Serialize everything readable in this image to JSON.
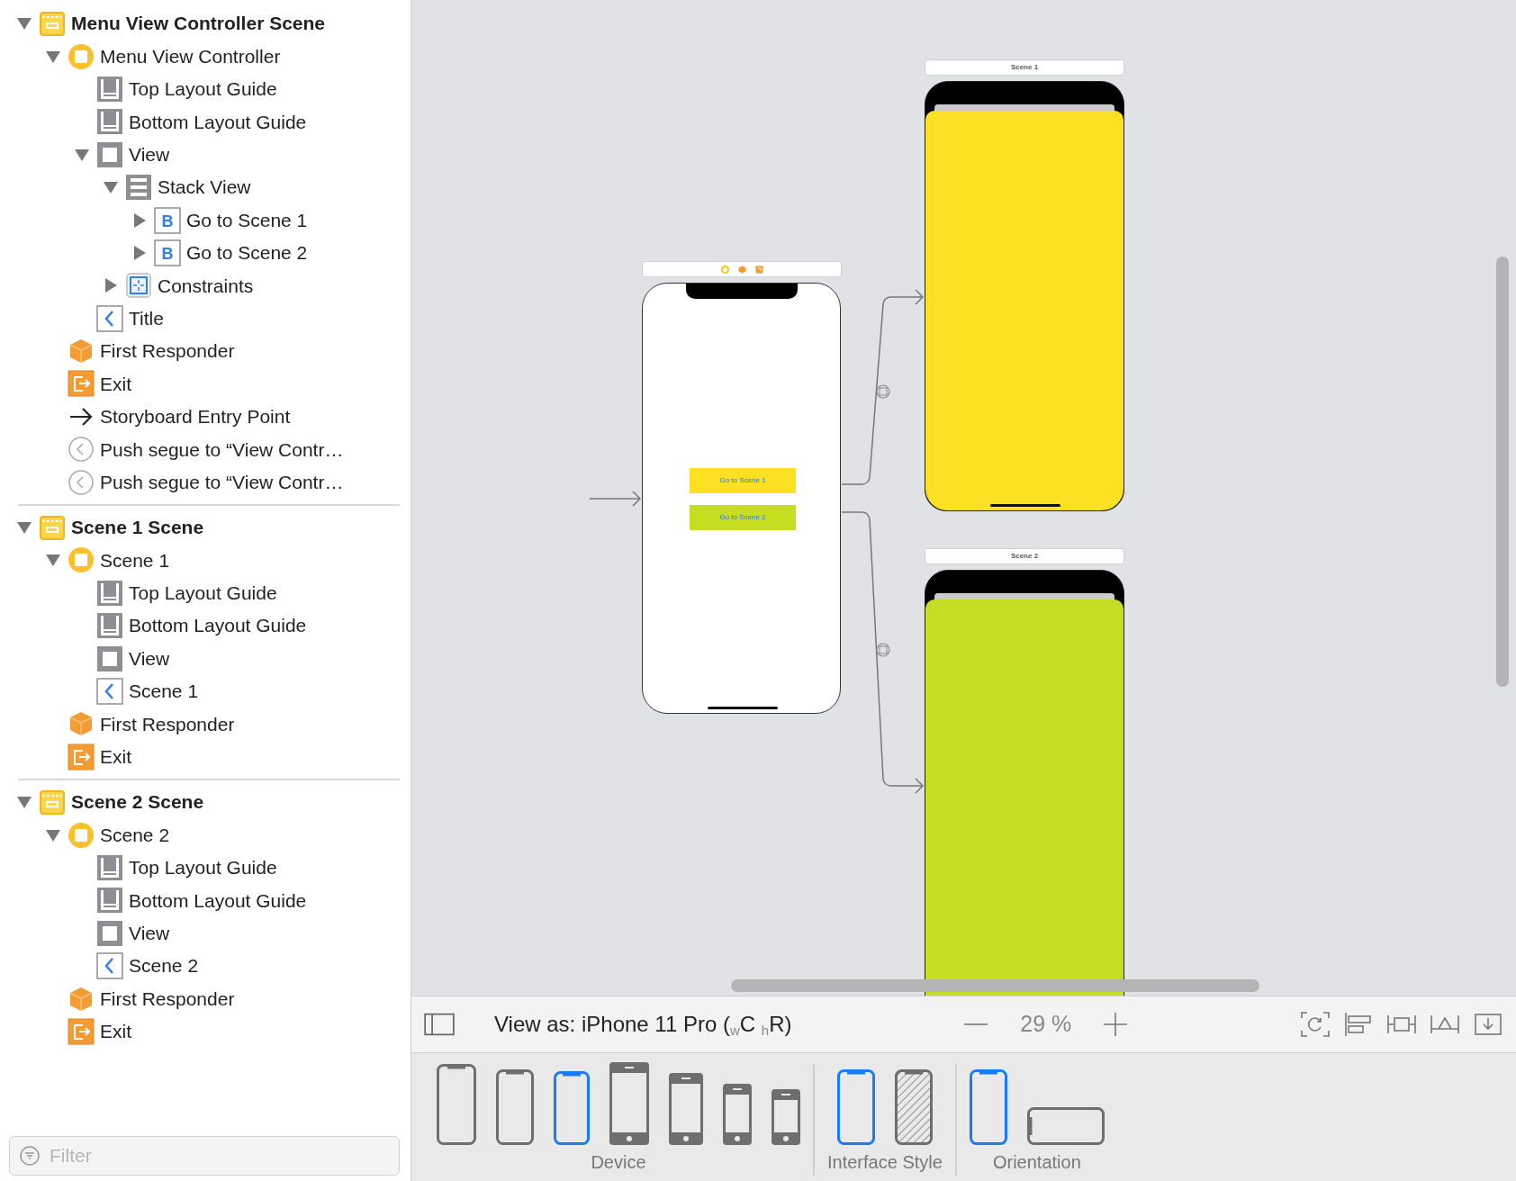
{
  "outline": {
    "scenes": [
      {
        "title": "Menu View Controller Scene",
        "expanded": true,
        "children": [
          {
            "label": "Menu View Controller",
            "kind": "controller",
            "expanded": true,
            "children": [
              {
                "label": "Top Layout Guide",
                "kind": "guide"
              },
              {
                "label": "Bottom Layout Guide",
                "kind": "guide"
              },
              {
                "label": "View",
                "kind": "view",
                "expanded": true,
                "children": [
                  {
                    "label": "Stack View",
                    "kind": "stack",
                    "expanded": true,
                    "children": [
                      {
                        "label": "Go to Scene 1",
                        "kind": "button",
                        "glyph": "B",
                        "expanded": false
                      },
                      {
                        "label": "Go to Scene 2",
                        "kind": "button",
                        "glyph": "B",
                        "expanded": false
                      }
                    ]
                  },
                  {
                    "label": "Constraints",
                    "kind": "constraints",
                    "expanded": false
                  }
                ]
              },
              {
                "label": "Title",
                "kind": "navitem"
              }
            ]
          },
          {
            "label": "First Responder",
            "kind": "responder"
          },
          {
            "label": "Exit",
            "kind": "exit"
          },
          {
            "label": "Storyboard Entry Point",
            "kind": "entry"
          },
          {
            "label": "Push segue to “View Contr…",
            "kind": "segue"
          },
          {
            "label": "Push segue to “View Contr…",
            "kind": "segue"
          }
        ]
      },
      {
        "title": "Scene 1 Scene",
        "expanded": true,
        "children": [
          {
            "label": "Scene 1",
            "kind": "controller",
            "expanded": true,
            "children": [
              {
                "label": "Top Layout Guide",
                "kind": "guide"
              },
              {
                "label": "Bottom Layout Guide",
                "kind": "guide"
              },
              {
                "label": "View",
                "kind": "view"
              },
              {
                "label": "Scene 1",
                "kind": "navitem"
              }
            ]
          },
          {
            "label": "First Responder",
            "kind": "responder"
          },
          {
            "label": "Exit",
            "kind": "exit"
          }
        ]
      },
      {
        "title": "Scene 2 Scene",
        "expanded": true,
        "children": [
          {
            "label": "Scene 2",
            "kind": "controller",
            "expanded": true,
            "children": [
              {
                "label": "Top Layout Guide",
                "kind": "guide"
              },
              {
                "label": "Bottom Layout Guide",
                "kind": "guide"
              },
              {
                "label": "View",
                "kind": "view"
              },
              {
                "label": "Scene 2",
                "kind": "navitem"
              }
            ]
          },
          {
            "label": "First Responder",
            "kind": "responder"
          },
          {
            "label": "Exit",
            "kind": "exit"
          }
        ]
      }
    ],
    "filter": {
      "placeholder": "Filter"
    }
  },
  "canvas": {
    "menu_buttons": [
      {
        "label": "Go to Scene 1",
        "color": "#fbe024"
      },
      {
        "label": "Go to Scene 2",
        "color": "#c6dd22"
      }
    ],
    "scenes": [
      {
        "title": "Scene 1",
        "color": "#fbe024"
      },
      {
        "title": "Scene 2",
        "color": "#c6dd22"
      }
    ]
  },
  "toolbar": {
    "view_as": "View as: iPhone 11 Pro ($_{w}$C $_{h}$R)",
    "zoom": "29 %"
  },
  "configuration": {
    "groups": [
      {
        "label": "Device",
        "options": [
          {
            "kind": "notch",
            "selected": false
          },
          {
            "kind": "notch",
            "selected": false
          },
          {
            "kind": "notch",
            "selected": true
          },
          {
            "kind": "home",
            "selected": false
          },
          {
            "kind": "home",
            "selected": false
          },
          {
            "kind": "home",
            "selected": false
          },
          {
            "kind": "home",
            "selected": false
          }
        ]
      },
      {
        "label": "Interface Style",
        "options": [
          {
            "kind": "light",
            "selected": true
          },
          {
            "kind": "dark",
            "selected": false
          }
        ]
      },
      {
        "label": "Orientation",
        "options": [
          {
            "kind": "portrait",
            "selected": true
          },
          {
            "kind": "landscape",
            "selected": false
          }
        ]
      }
    ]
  }
}
